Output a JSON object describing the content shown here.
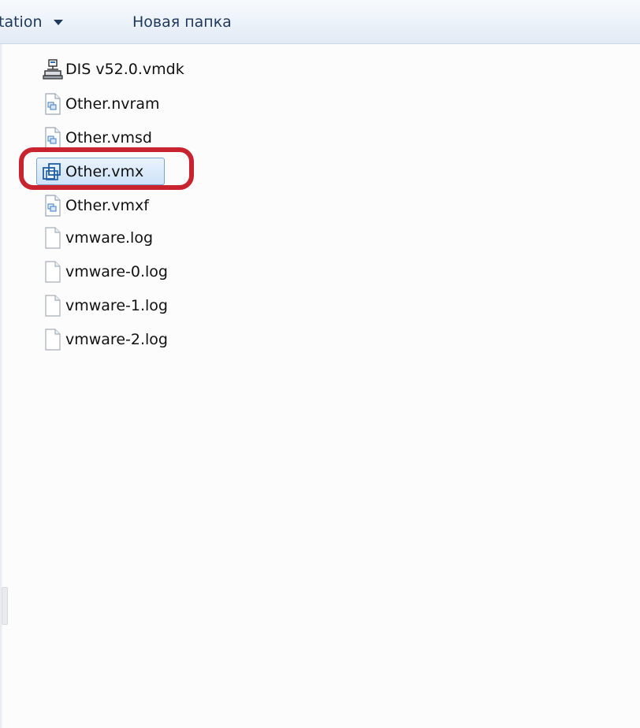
{
  "toolbar": {
    "partial_button_label": "tation",
    "new_folder_label": "Новая папка"
  },
  "files": [
    {
      "name": "DIS v52.0.vmdk",
      "icon": "vmdk-disk-icon"
    },
    {
      "name": "Other.nvram",
      "icon": "vmware-file-icon"
    },
    {
      "name": "Other.vmsd",
      "icon": "vmware-file-icon"
    },
    {
      "name": "Other.vmx",
      "icon": "vmx-vm-icon",
      "selected": true,
      "highlighted": true
    },
    {
      "name": "Other.vmxf",
      "icon": "vmware-file-icon"
    },
    {
      "name": "vmware.log",
      "icon": "text-file-icon"
    },
    {
      "name": "vmware-0.log",
      "icon": "text-file-icon"
    },
    {
      "name": "vmware-1.log",
      "icon": "text-file-icon"
    },
    {
      "name": "vmware-2.log",
      "icon": "text-file-icon"
    }
  ],
  "colors": {
    "highlight_ring": "#c8232f",
    "selection_fill": "#cde2f9",
    "selection_border": "#7da2ce",
    "toolbar_text": "#1e395b"
  }
}
